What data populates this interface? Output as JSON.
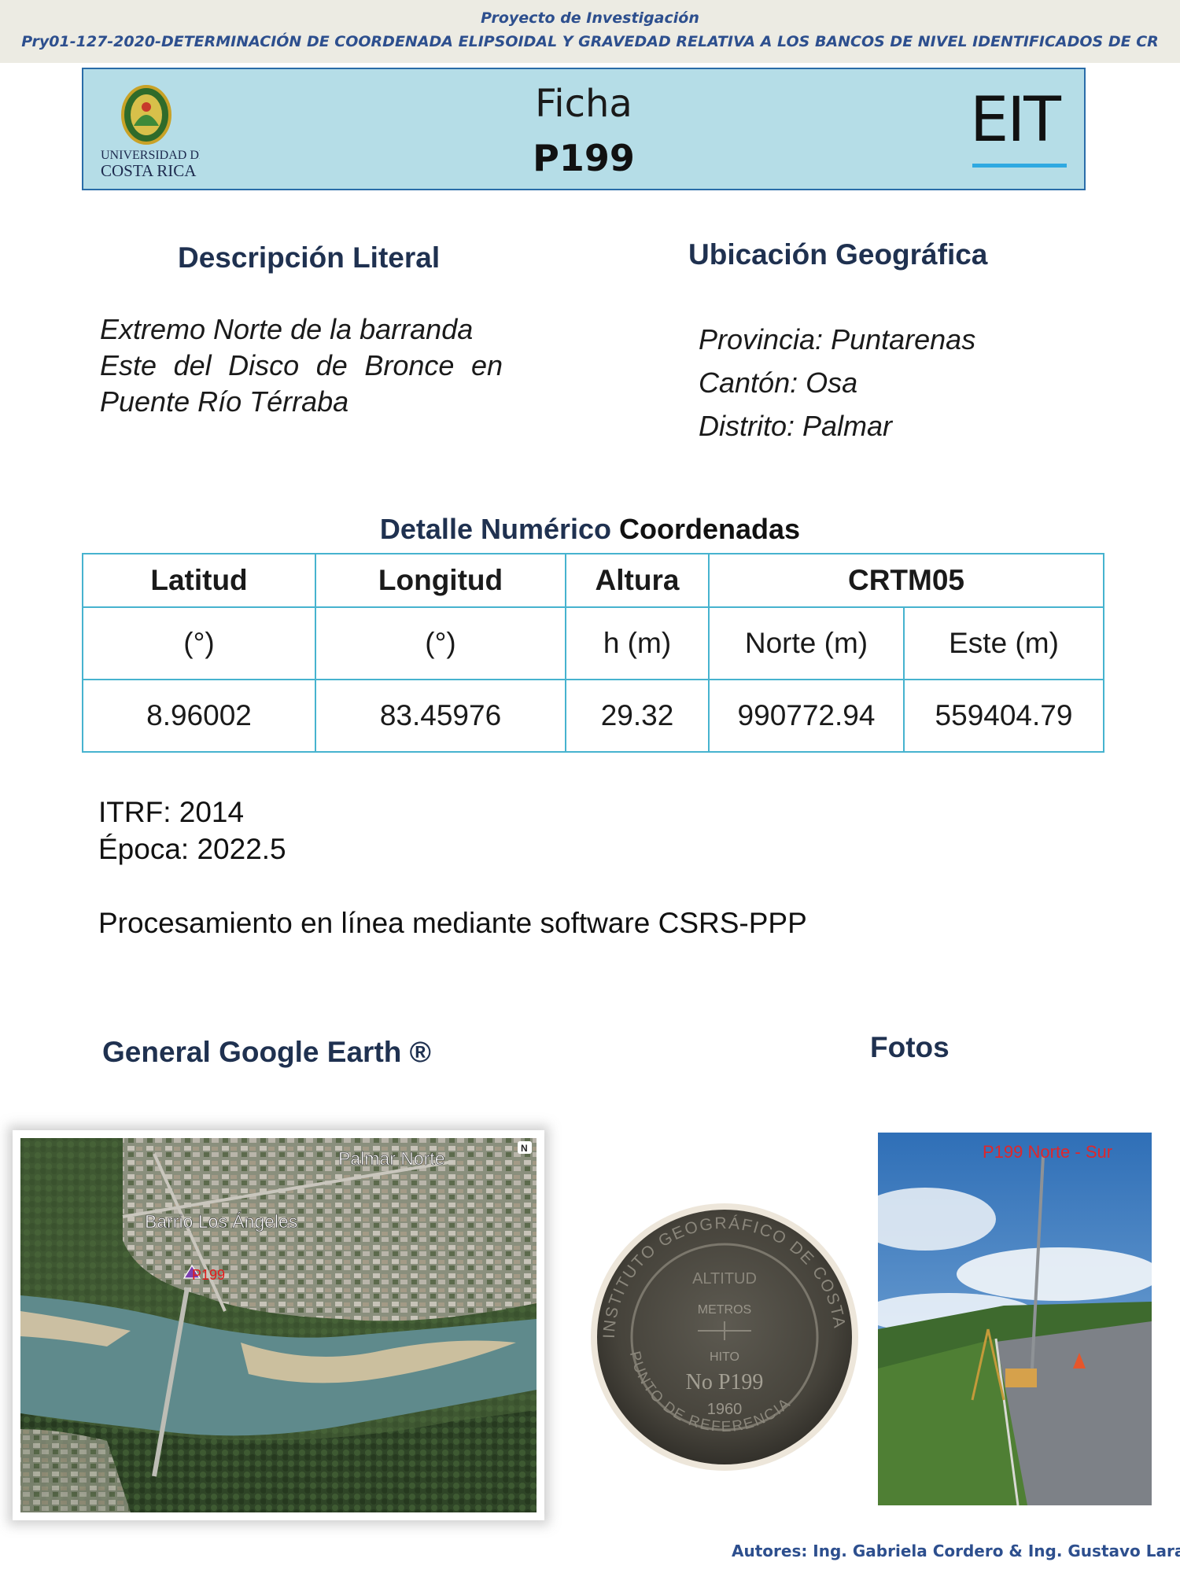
{
  "banner": {
    "line1": "Proyecto de Investigación",
    "line2": "Pry01-127-2020-DETERMINACIÓN DE COORDENADA ELIPSOIDAL Y GRAVEDAD RELATIVA A LOS BANCOS DE NIVEL IDENTIFICADOS DE CR"
  },
  "header": {
    "logo_line1": "UNIVERSIDAD DE",
    "logo_line2": "COSTA RICA",
    "title": "Ficha",
    "code": "P199",
    "brand": "EIT"
  },
  "descripcion": {
    "title": "Descripción Literal",
    "lines": [
      "Extremo Norte de la barranda",
      "Este del Disco de Bronce en",
      "Puente Río Térraba"
    ]
  },
  "ubicacion": {
    "title": "Ubicación Geográfica",
    "provincia": "Provincia: Puntarenas",
    "canton": "Cantón: Osa",
    "distrito": "Distrito: Palmar"
  },
  "detalle": {
    "title_part1": "Detalle Numérico",
    "title_part2": "Coordenadas",
    "headers": [
      "Latitud",
      "Longitud",
      "Altura",
      "CRTM05"
    ],
    "units": [
      "(°)",
      "(°)",
      "h (m)",
      "Norte (m)",
      "Este (m)"
    ],
    "values": [
      "8.96002",
      "83.45976",
      "29.32",
      "990772.94",
      "559404.79"
    ]
  },
  "notes": {
    "itrf": "ITRF: 2014",
    "epoca": "Época: 2022.5",
    "procesamiento": "Procesamiento en línea mediante software CSRS-PPP"
  },
  "map": {
    "title": "General Google Earth ®",
    "label_palmar": "Palmar Norte",
    "label_barrio": "Barrio Los Ángeles",
    "label_point": "P199",
    "north": "N"
  },
  "fotos": {
    "title": "Fotos",
    "disk_ring": "INSTITUTO GEOGRÁFICO DE COSTA RICA",
    "disk_bottom": "PUNTO DE REFERENCIA",
    "disk_altitud": "ALTITUD",
    "disk_metros": "METROS",
    "disk_hito": "HITO",
    "disk_no": "No P199",
    "disk_year": "1960",
    "photo_caption": "P199 Norte - Sur"
  },
  "footer": {
    "authors": "Autores: Ing. Gabriela Cordero & Ing. Gustavo Lara"
  }
}
